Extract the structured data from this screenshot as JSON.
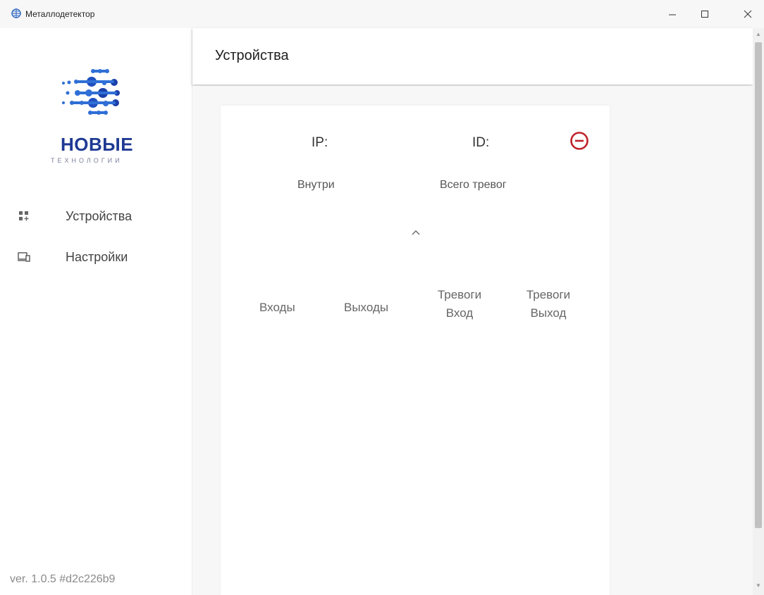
{
  "window": {
    "title": "Металлодетектор",
    "minimize_icon": "minimize-icon",
    "maximize_icon": "maximize-icon",
    "close_icon": "close-icon"
  },
  "sidebar": {
    "logo": {
      "word": "НОВЫЕ",
      "subtitle": "ТЕХНОЛОГИИ"
    },
    "items": [
      {
        "label": "Устройства",
        "icon": "devices-add-icon"
      },
      {
        "label": "Настройки",
        "icon": "monitor-devices-icon"
      }
    ],
    "version": "ver. 1.0.5 #d2c226b9"
  },
  "header": {
    "title": "Устройства"
  },
  "device_card": {
    "ip_label": "IP:",
    "id_label": "ID:",
    "inside_label": "Внутри",
    "total_alarms_label": "Всего тревог",
    "columns": [
      {
        "line1": "Входы",
        "line2": ""
      },
      {
        "line1": "Выходы",
        "line2": ""
      },
      {
        "line1": "Тревоги",
        "line2": "Вход"
      },
      {
        "line1": "Тревоги",
        "line2": "Выход"
      }
    ]
  },
  "colors": {
    "brand_blue": "#1f3a93",
    "remove_red": "#c0202a"
  }
}
